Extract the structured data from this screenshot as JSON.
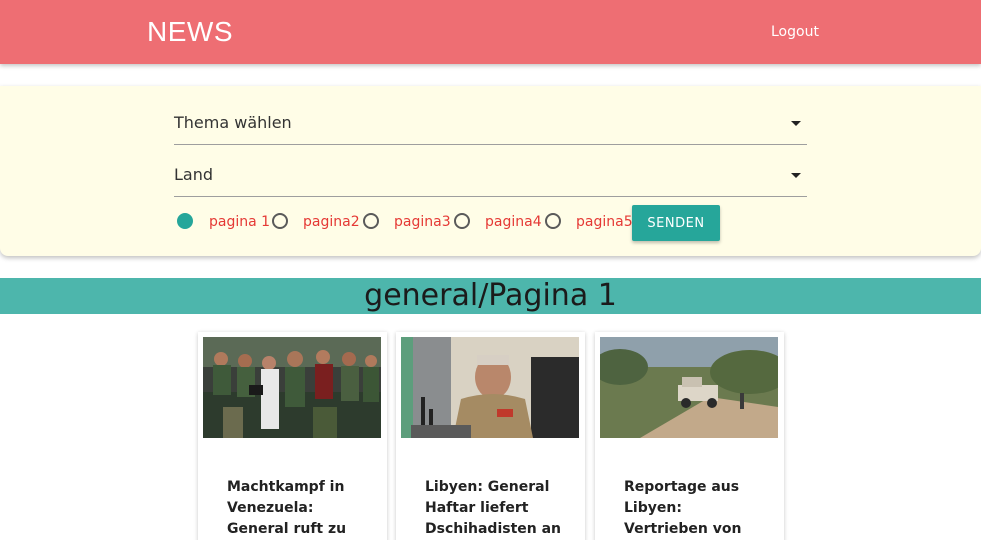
{
  "navbar": {
    "brand": "NEWS",
    "logout": "Logout"
  },
  "filters": {
    "topic_select": "Thema wählen",
    "country_select": "Land",
    "pages": [
      {
        "label": "pagina 1",
        "checked": true
      },
      {
        "label": "pagina2",
        "checked": false
      },
      {
        "label": "pagina3",
        "checked": false
      },
      {
        "label": "pagina4",
        "checked": false
      },
      {
        "label": "pagina5",
        "checked": false
      }
    ],
    "send_button": "SENDEN"
  },
  "section": {
    "title": "general/Pagina 1"
  },
  "articles": [
    {
      "title": "Machtkampf in Venezuela: General ruft zu Aufstand"
    },
    {
      "title": "Libyen: General Haftar liefert Dschihadisten an"
    },
    {
      "title": "Reportage aus Libyen: Vertrieben von General Haftar"
    }
  ],
  "colors": {
    "navbar": "#ee6e73",
    "filter_bg": "#fffde7",
    "accent": "#26a69a",
    "section_bar": "#4db6ac",
    "page_label": "#e53935"
  }
}
